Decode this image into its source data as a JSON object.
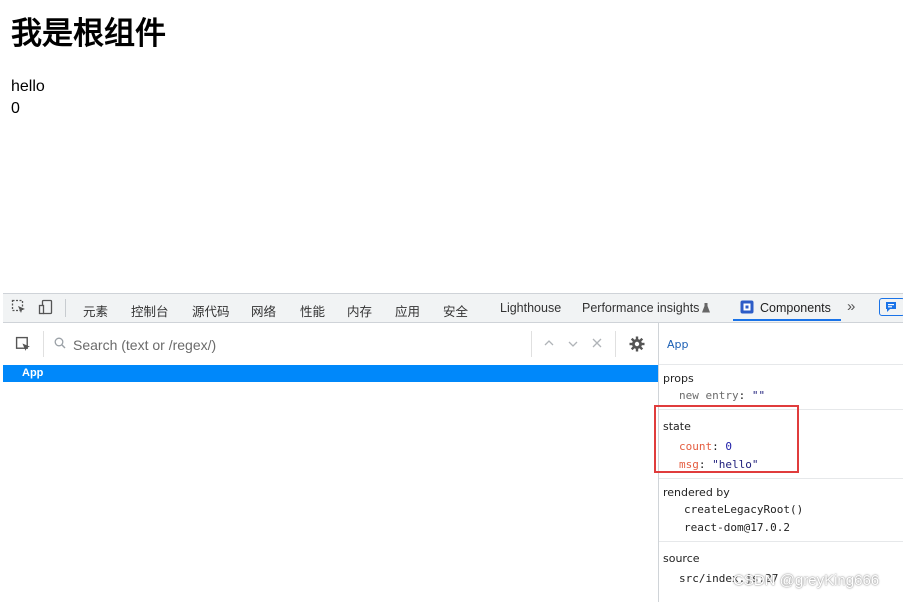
{
  "page": {
    "heading": "我是根组件",
    "msg": "hello",
    "count": "0"
  },
  "devtools": {
    "tabs": [
      "元素",
      "控制台",
      "源代码",
      "网络",
      "性能",
      "内存",
      "应用",
      "安全",
      "Lighthouse",
      "Performance insights",
      "Components"
    ],
    "active_tab": "Components",
    "more_tabs_glyph": "»"
  },
  "components": {
    "search_placeholder": "Search (text or /regex/)",
    "tree": [
      {
        "label": "App",
        "selected": true
      }
    ]
  },
  "inspector": {
    "component_name": "App",
    "props_header": "props",
    "props": [
      {
        "key": "new entry",
        "value": "\"\""
      }
    ],
    "state_header": "state",
    "state": [
      {
        "key": "count",
        "value": "0"
      },
      {
        "key": "msg",
        "value": "\"hello\""
      }
    ],
    "rendered_by_header": "rendered by",
    "rendered_by": [
      "createLegacyRoot()",
      "react-dom@17.0.2"
    ],
    "source_header": "source",
    "source": "src/index.js:27"
  },
  "watermark": "CSDN @greyKing666",
  "colors": {
    "selection": "#0088fa",
    "highlight_box": "#e03c3c",
    "active_underline": "#1a73e8"
  }
}
